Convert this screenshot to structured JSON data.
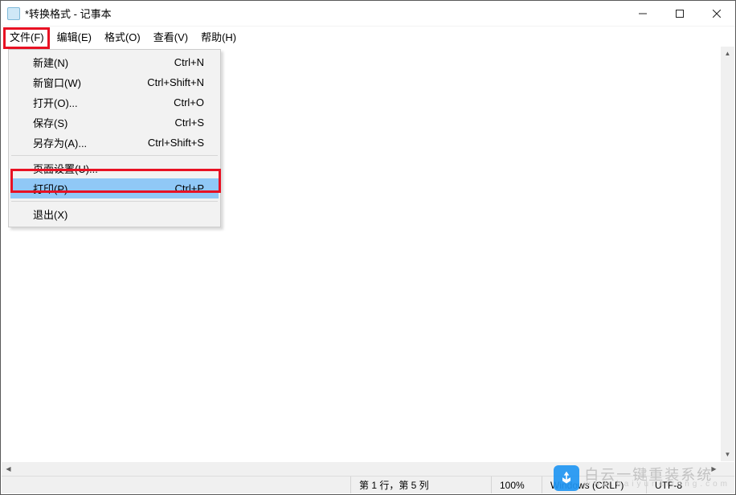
{
  "window": {
    "title": "*转换格式 - 记事本"
  },
  "menubar": {
    "items": [
      {
        "label": "文件(F)"
      },
      {
        "label": "编辑(E)"
      },
      {
        "label": "格式(O)"
      },
      {
        "label": "查看(V)"
      },
      {
        "label": "帮助(H)"
      }
    ]
  },
  "filemenu": {
    "items": [
      {
        "label": "新建(N)",
        "shortcut": "Ctrl+N"
      },
      {
        "label": "新窗口(W)",
        "shortcut": "Ctrl+Shift+N"
      },
      {
        "label": "打开(O)...",
        "shortcut": "Ctrl+O"
      },
      {
        "label": "保存(S)",
        "shortcut": "Ctrl+S"
      },
      {
        "label": "另存为(A)...",
        "shortcut": "Ctrl+Shift+S"
      },
      {
        "label": "页面设置(U)...",
        "shortcut": ""
      },
      {
        "label": "打印(P)...",
        "shortcut": "Ctrl+P"
      },
      {
        "label": "退出(X)",
        "shortcut": ""
      }
    ]
  },
  "statusbar": {
    "position": "第 1 行，第 5 列",
    "zoom": "100%",
    "lineending": "Windows (CRLF)",
    "encoding": "UTF-8"
  },
  "watermark": {
    "text1": "白云一键重装系统",
    "text2": "www.baiyunxitong.com"
  }
}
